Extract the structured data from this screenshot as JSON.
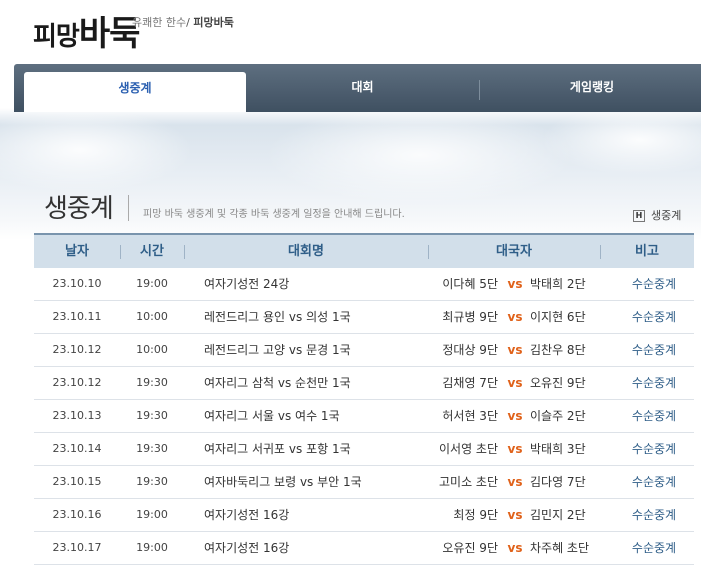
{
  "header": {
    "logo_part1": "피망",
    "logo_part2": "바둑",
    "slogan": "유쾌한 한수",
    "slogan_sep": "/",
    "slogan_brand": "피망바둑"
  },
  "nav": {
    "tabs": [
      {
        "label": "생중계"
      },
      {
        "label": "대회"
      },
      {
        "label": "게임랭킹"
      }
    ]
  },
  "page": {
    "title": "생중계",
    "description": "피망 바둑 생중계 및 각종 바둑 생중계 일정을 안내해 드립니다.",
    "breadcrumb_icon": "H",
    "breadcrumb": "생중계"
  },
  "table": {
    "headers": {
      "date": "날자",
      "time": "시간",
      "event": "대회명",
      "players": "대국자",
      "note": "비고"
    },
    "vs_label": "vs",
    "rows": [
      {
        "date": "23.10.10",
        "time": "19:00",
        "event": "여자기성전 24강",
        "p1": "이다혜 5단",
        "p2": "박태희 2단",
        "note": "수순중계"
      },
      {
        "date": "23.10.11",
        "time": "10:00",
        "event": "레전드리그 용인 vs 의성 1국",
        "p1": "최규병 9단",
        "p2": "이지현 6단",
        "note": "수순중계"
      },
      {
        "date": "23.10.12",
        "time": "10:00",
        "event": "레전드리그 고양 vs 문경 1국",
        "p1": "정대상 9단",
        "p2": "김찬우 8단",
        "note": "수순중계"
      },
      {
        "date": "23.10.12",
        "time": "19:30",
        "event": "여자리그 삼척 vs 순천만 1국",
        "p1": "김채영 7단",
        "p2": "오유진 9단",
        "note": "수순중계"
      },
      {
        "date": "23.10.13",
        "time": "19:30",
        "event": "여자리그 서울 vs 여수 1국",
        "p1": "허서현 3단",
        "p2": "이슬주 2단",
        "note": "수순중계"
      },
      {
        "date": "23.10.14",
        "time": "19:30",
        "event": "여자리그 서귀포 vs 포항 1국",
        "p1": "이서영 초단",
        "p2": "박태희 3단",
        "note": "수순중계"
      },
      {
        "date": "23.10.15",
        "time": "19:30",
        "event": "여자바둑리그 보령 vs 부안 1국",
        "p1": "고미소 초단",
        "p2": "김다영 7단",
        "note": "수순중계"
      },
      {
        "date": "23.10.16",
        "time": "19:00",
        "event": "여자기성전 16강",
        "p1": "최정 9단",
        "p2": "김민지 2단",
        "note": "수순중계"
      },
      {
        "date": "23.10.17",
        "time": "19:00",
        "event": "여자기성전 16강",
        "p1": "오유진 9단",
        "p2": "차주혜 초단",
        "note": "수순중계"
      }
    ]
  }
}
